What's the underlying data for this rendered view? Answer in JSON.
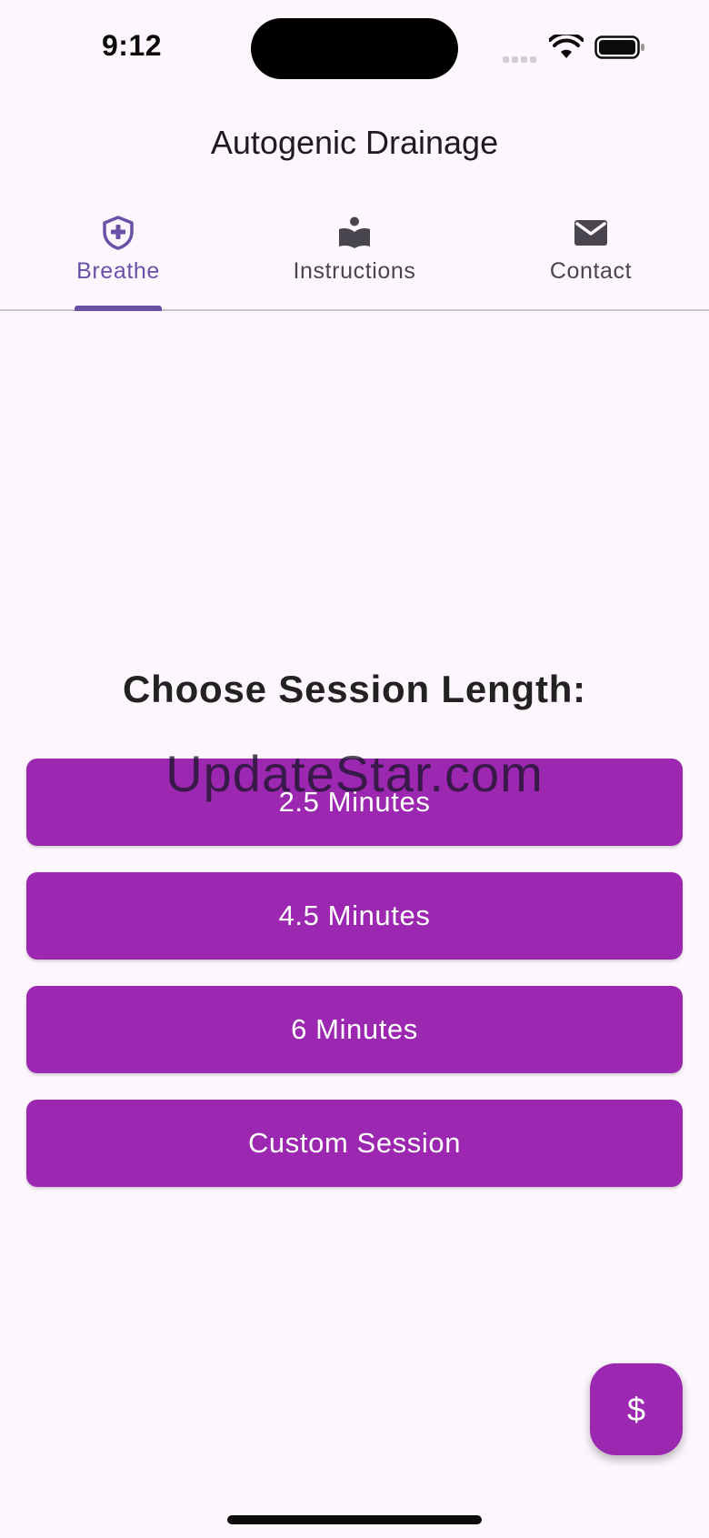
{
  "status_bar": {
    "time": "9:12",
    "icons": [
      "signal-icon",
      "wifi-icon",
      "battery-icon"
    ]
  },
  "app_bar": {
    "title": "Autogenic Drainage"
  },
  "tabs": [
    {
      "label": "Breathe",
      "icon": "health-shield-icon",
      "active": true
    },
    {
      "label": "Instructions",
      "icon": "reading-book-icon",
      "active": false
    },
    {
      "label": "Contact",
      "icon": "mail-icon",
      "active": false
    }
  ],
  "main": {
    "heading": "Choose Session Length:",
    "watermark": "UpdateStar.com",
    "buttons": [
      {
        "label": "2.5 Minutes"
      },
      {
        "label": "4.5 Minutes"
      },
      {
        "label": "6 Minutes"
      },
      {
        "label": "Custom Session"
      }
    ]
  },
  "fab": {
    "label": "$",
    "icon": "dollar-icon"
  },
  "colors": {
    "background": "#fdf7fd",
    "button": "#9c27b0",
    "tab_active": "#6a50a7",
    "tab_inactive": "#49454f",
    "divider": "#cac4cf"
  }
}
